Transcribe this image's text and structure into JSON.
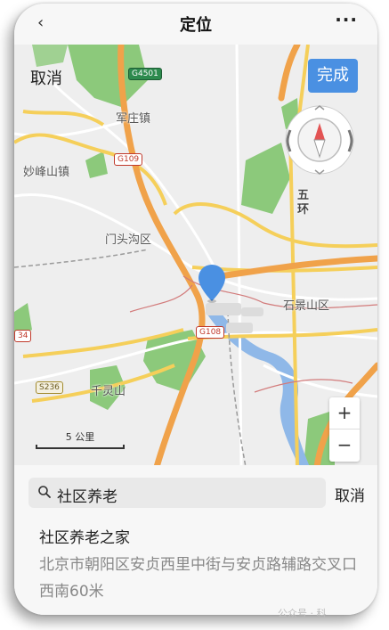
{
  "header": {
    "back_icon": "chevron-left-icon",
    "title": "定位",
    "more_icon": "more-dots-icon",
    "more_glyph": "···"
  },
  "map_top": {
    "cancel_label": "取消",
    "done_label": "完成"
  },
  "map": {
    "labels": {
      "junzhuang": "军庄镇",
      "miaofengshan": "妙峰山镇",
      "mentougou": "门头沟区",
      "shijingshan": "石景山区",
      "qianlingshan": "千灵山",
      "fifth_ring_1": "五",
      "fifth_ring_2": "环"
    },
    "shields": {
      "g4501": "G4501",
      "g109": "G109",
      "g108": "G108",
      "s236": "S236",
      "left_red": "34"
    },
    "scale_label": "5 公里",
    "zoom_in": "+",
    "zoom_out": "−",
    "colors": {
      "park": "#8cc97b",
      "highway": "#f0a24a",
      "major_road": "#f5cf5a",
      "water": "#8fb8e8",
      "pin": "#4a90e2",
      "done_button": "#4a90e2"
    }
  },
  "search": {
    "value": "社区养老",
    "cancel_label": "取消"
  },
  "results": [
    {
      "name": "社区养老之家",
      "address": "北京市朝阳区安贞西里中街与安贞路辅路交叉口西南60米"
    }
  ],
  "watermark": "公众号 · 科"
}
